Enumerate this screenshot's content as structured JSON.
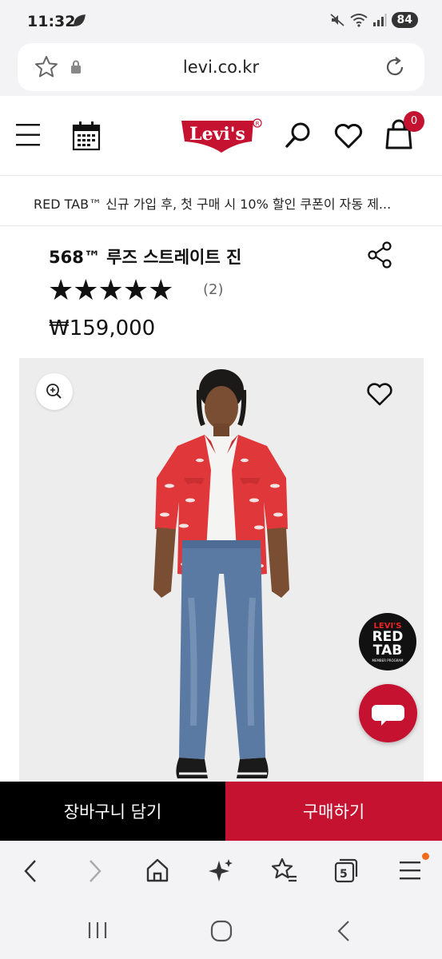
{
  "status_bar": {
    "time": "11:32",
    "battery": "84"
  },
  "browser": {
    "url": "levi.co.kr",
    "tab_count": "5"
  },
  "header": {
    "logo": "Levi's",
    "cart_count": "0"
  },
  "promo": {
    "text": "RED TAB™ 신규 가입 후, 첫 구매 시 10% 할인 쿠폰이 자동 제..."
  },
  "product": {
    "name": "568™ 루즈 스트레이트 진",
    "rating_stars": "★★★★★",
    "rating": 5,
    "review_count": "(2)",
    "price": "₩159,000"
  },
  "red_tab_badge": {
    "line1": "LEVI'S",
    "line2a": "RED",
    "line2b": "TAB",
    "line3": "MEMBER PROGRAM"
  },
  "actions": {
    "add_to_cart": "장바구니 담기",
    "buy_now": "구매하기"
  },
  "colors": {
    "brand_red": "#c41230",
    "shirt_red": "#e0383a",
    "denim": "#5b7aa3"
  }
}
